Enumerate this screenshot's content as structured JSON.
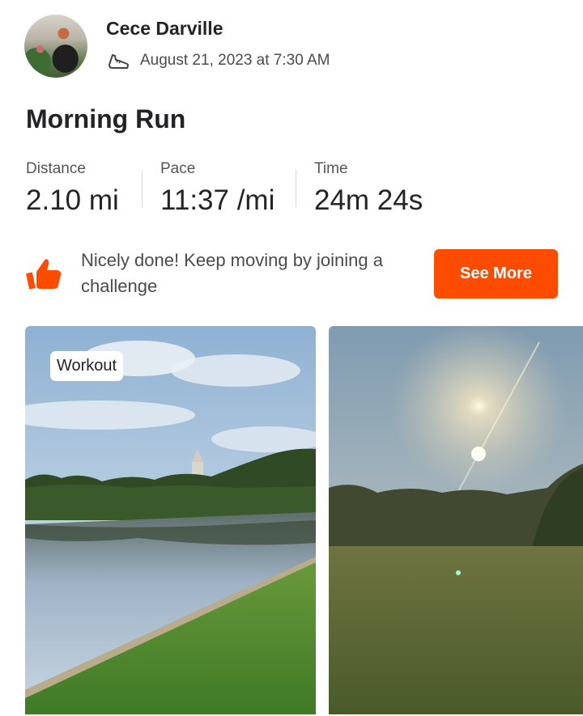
{
  "athlete": {
    "name": "Cece Darville",
    "activity_icon": "running-shoe-icon",
    "date": "August 21, 2023 at 7:30 AM"
  },
  "activity": {
    "title": "Morning Run",
    "stats": [
      {
        "label": "Distance",
        "value": "2.10 mi"
      },
      {
        "label": "Pace",
        "value": "11:37 /mi"
      },
      {
        "label": "Time",
        "value": "24m 24s"
      }
    ]
  },
  "promo": {
    "icon": "thumbs-up-icon",
    "text": "Nicely done! Keep moving by joining a challenge",
    "button_label": "See More"
  },
  "photos": {
    "badge": "Workout"
  },
  "colors": {
    "accent": "#fc4c02",
    "text": "#242428"
  }
}
